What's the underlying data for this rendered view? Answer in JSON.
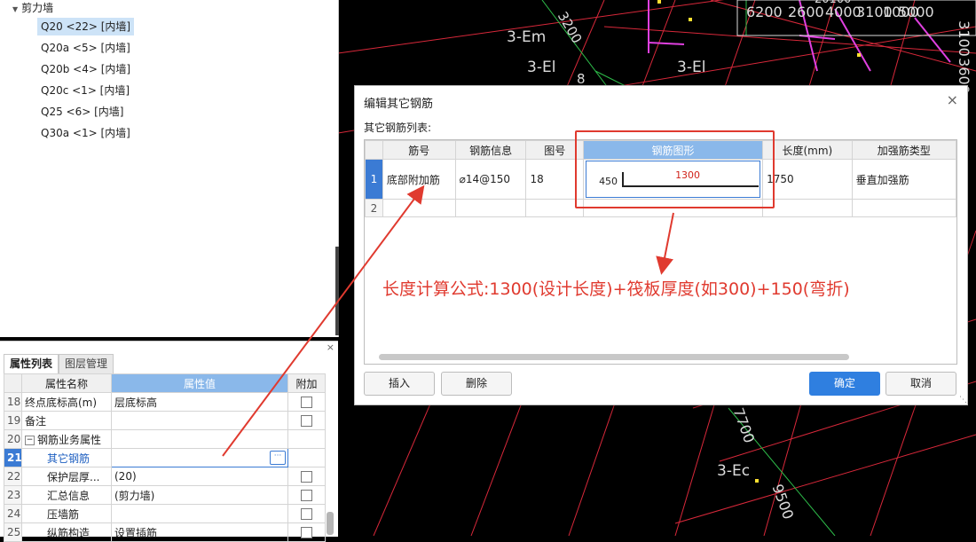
{
  "tree": {
    "root_label": "剪力墙",
    "items": [
      "Q20 <22> [内墙]",
      "Q20a <5> [内墙]",
      "Q20b <4> [内墙]",
      "Q20c <1> [内墙]",
      "Q25 <6> [内墙]",
      "Q30a <1> [内墙]"
    ],
    "selected_index": 0
  },
  "props": {
    "close_glyph": "×",
    "tabs": [
      "属性列表",
      "图层管理"
    ],
    "headers": {
      "name": "属性名称",
      "value": "属性值",
      "extra": "附加"
    },
    "rows": [
      {
        "num": "18",
        "name": "终点底标高(m)",
        "value": "层底标高",
        "check": true
      },
      {
        "num": "19",
        "name": "备注",
        "value": "",
        "check": true
      },
      {
        "num": "20",
        "name": "钢筋业务属性",
        "value": "",
        "check": false,
        "expander": "−"
      },
      {
        "num": "21",
        "name": "其它钢筋",
        "value": "",
        "check": false,
        "editing": true,
        "button": "···"
      },
      {
        "num": "22",
        "name": "保护层厚...",
        "value": "(20)",
        "check": true
      },
      {
        "num": "23",
        "name": "汇总信息",
        "value": "(剪力墙)",
        "check": true
      },
      {
        "num": "24",
        "name": "压墙筋",
        "value": "",
        "check": true
      },
      {
        "num": "25",
        "name": "纵筋构造",
        "value": "设置插筋",
        "check": true
      }
    ]
  },
  "cad": {
    "labels": [
      "3-Em",
      "3-El",
      "3-El",
      "3-Ec",
      "3200",
      "6200",
      "2600",
      "4000",
      "3100",
      "1000",
      "5000",
      "20100",
      "7700",
      "9500",
      "3100",
      "3600",
      "8"
    ]
  },
  "dialog": {
    "title": "编辑其它钢筋",
    "close_glyph": "×",
    "list_label": "其它钢筋列表:",
    "columns": [
      "筋号",
      "钢筋信息",
      "图号",
      "钢筋图形",
      "长度(mm)",
      "加强筋类型"
    ],
    "rows": [
      {
        "num": "1",
        "name": "底部附加筋",
        "info": "⌀14@150",
        "fig": "18",
        "shape_left": "450",
        "shape_main": "1300",
        "length": "1750",
        "type": "垂直加强筋"
      },
      {
        "num": "2",
        "name": "",
        "info": "",
        "fig": "",
        "length": "",
        "type": ""
      }
    ],
    "buttons": {
      "insert": "插入",
      "delete": "删除",
      "ok": "确定",
      "cancel": "取消"
    },
    "resize_glyph": "⋱"
  },
  "annotation": {
    "formula": "长度计算公式:1300(设计长度)+筏板厚度(如300)+150(弯折)",
    "color": "#e03a2f"
  }
}
